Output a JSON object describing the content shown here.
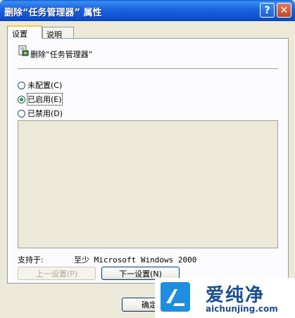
{
  "window": {
    "title": "删除“任务管理器” 属性",
    "help_label": "?",
    "close_label": "✕"
  },
  "tabs": [
    {
      "label": "设置",
      "active": true
    },
    {
      "label": "说明",
      "active": false
    }
  ],
  "policy": {
    "icon": "policy-setting-icon",
    "name": "删除“任务管理器”"
  },
  "options": [
    {
      "label": "未配置(C)",
      "checked": false
    },
    {
      "label": "已启用(E)",
      "checked": true
    },
    {
      "label": "已禁用(D)",
      "checked": false
    }
  ],
  "supported": {
    "label": "支持于:",
    "value": "至少 Microsoft Windows 2000"
  },
  "buttons": {
    "prev": "上一设置(P)",
    "next": "下一设置(N)",
    "ok": "确定"
  },
  "watermark": {
    "text": "爱纯净",
    "url": "aichunjing.com",
    "accent": "#1F8DE0"
  }
}
